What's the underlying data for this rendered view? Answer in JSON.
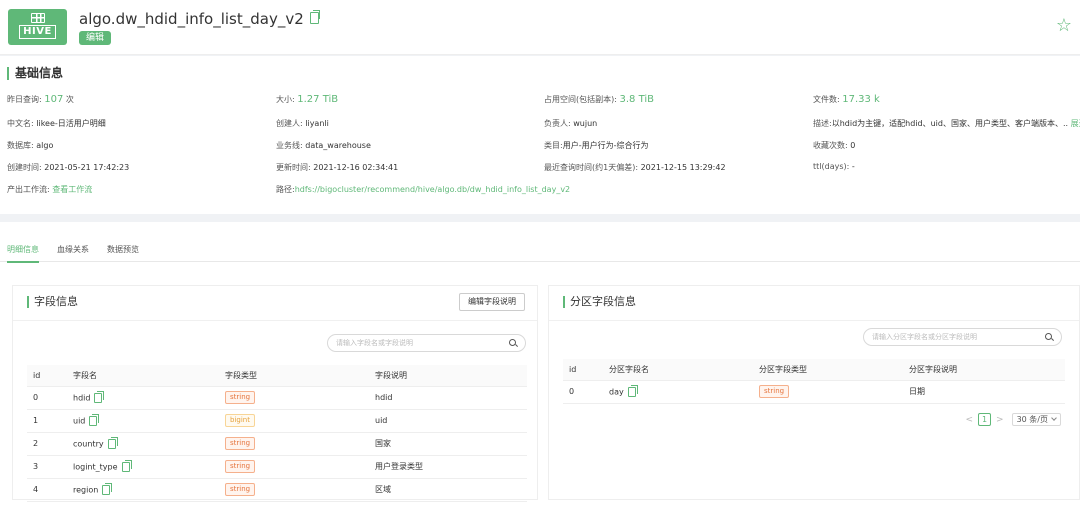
{
  "header": {
    "logo_text": "HIVE",
    "title": "algo.dw_hdid_info_list_day_v2",
    "edit_label": "编辑"
  },
  "basic": {
    "section_title": "基础信息",
    "fields": [
      {
        "label": "昨日查询:",
        "value": "107",
        "suffix": "次"
      },
      {
        "label": "大小:",
        "value": "1.27 TiB"
      },
      {
        "label": "占用空间(包括副本):",
        "value": "3.8 TiB"
      },
      {
        "label": "文件数:",
        "value": "17.33 k"
      },
      {
        "label": "中文名:",
        "value": "likee-日活用户明细"
      },
      {
        "label": "创建人:",
        "value": "liyanli"
      },
      {
        "label": "负责人:",
        "value": "wujun"
      },
      {
        "label": "描述:",
        "value": "以hdid为主键，适配hdid、uid、国家、用户类型、客户端版本、..",
        "action": "展开"
      },
      {
        "label": "数据库:",
        "value": "algo"
      },
      {
        "label": "业务线:",
        "value": "data_warehouse"
      },
      {
        "label": "类目:",
        "value": "用户-用户行为-综合行为"
      },
      {
        "label": "收藏次数:",
        "value": "0"
      },
      {
        "label": "创建时间:",
        "value": "2021-05-21 17:42:23"
      },
      {
        "label": "更新时间:",
        "value": "2021-12-16 02:34:41"
      },
      {
        "label": "最近查询时间(约1天偏差):",
        "value": "2021-12-15 13:29:42"
      },
      {
        "label": "ttl(days):",
        "value": "-"
      },
      {
        "label": "产出工作流:",
        "value": "查看工作流"
      },
      {
        "label": "路径:",
        "value": "hdfs://bigocluster/recommend/hive/algo.db/dw_hdid_info_list_day_v2"
      }
    ]
  },
  "tabs": [
    "明细信息",
    "血缘关系",
    "数据预览"
  ],
  "fields_panel": {
    "title": "字段信息",
    "edit_button": "编辑字段说明",
    "search_placeholder": "请输入字段名或字段说明",
    "columns": [
      "id",
      "字段名",
      "字段类型",
      "字段说明"
    ],
    "rows": [
      {
        "id": "0",
        "name": "hdid",
        "type": "string",
        "desc": "hdid"
      },
      {
        "id": "1",
        "name": "uid",
        "type": "bigint",
        "desc": "uid"
      },
      {
        "id": "2",
        "name": "country",
        "type": "string",
        "desc": "国家"
      },
      {
        "id": "3",
        "name": "logint_type",
        "type": "string",
        "desc": "用户登录类型"
      },
      {
        "id": "4",
        "name": "region",
        "type": "string",
        "desc": "区域"
      }
    ]
  },
  "partition_panel": {
    "title": "分区字段信息",
    "search_placeholder": "请输入分区字段名或分区字段说明",
    "columns": [
      "id",
      "分区字段名",
      "分区字段类型",
      "分区字段说明"
    ],
    "rows": [
      {
        "id": "0",
        "name": "day",
        "type": "string",
        "desc": "日期"
      }
    ],
    "pager": {
      "prev": "<",
      "page": "1",
      "next": ">",
      "page_size": "30 条/页"
    }
  },
  "colors": {
    "accent": "#5fb878",
    "tag_string": "#e5753e",
    "tag_bigint": "#e6a23c"
  }
}
